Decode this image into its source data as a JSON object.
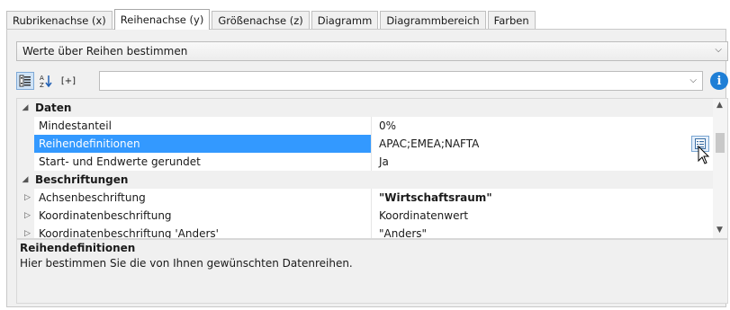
{
  "tabs": [
    {
      "label": "Rubrikenachse (x)",
      "active": false
    },
    {
      "label": "Reihenachse (y)",
      "active": true
    },
    {
      "label": "Größenachse (z)",
      "active": false
    },
    {
      "label": "Diagramm",
      "active": false
    },
    {
      "label": "Diagrammbereich",
      "active": false
    },
    {
      "label": "Farben",
      "active": false
    }
  ],
  "mode_select": {
    "value": "Werte über Reihen bestimmen"
  },
  "toolbar": {
    "categorized_icon": "categorized-view-icon",
    "alphabetical_icon": "sort-alphabetical-icon",
    "expand_label": "[+]",
    "filter_value": "",
    "info_label": "i"
  },
  "grid": {
    "categories": [
      {
        "label": "Daten",
        "rows": [
          {
            "name": "Mindestanteil",
            "value": "0%"
          },
          {
            "name": "Reihendefinitionen",
            "value": "APAC;EMEA;NAFTA",
            "selected": true
          },
          {
            "name": "Start- und Endwerte gerundet",
            "value": "Ja"
          }
        ]
      },
      {
        "label": "Beschriftungen",
        "rows": [
          {
            "name": "Achsenbeschriftung",
            "value": "\"Wirtschaftsraum\"",
            "bold": true
          },
          {
            "name": "Koordinatenbeschriftung",
            "value": "Koordinatenwert"
          },
          {
            "name": "Koordinatenbeschriftung 'Anders'",
            "value": "\"Anders\""
          }
        ]
      }
    ]
  },
  "description": {
    "title": "Reihendefinitionen",
    "text": "Hier bestimmen Sie die von Ihnen gewünschten Datenreihen."
  },
  "colors": {
    "selection": "#3399ff",
    "info": "#1f7fd6"
  }
}
